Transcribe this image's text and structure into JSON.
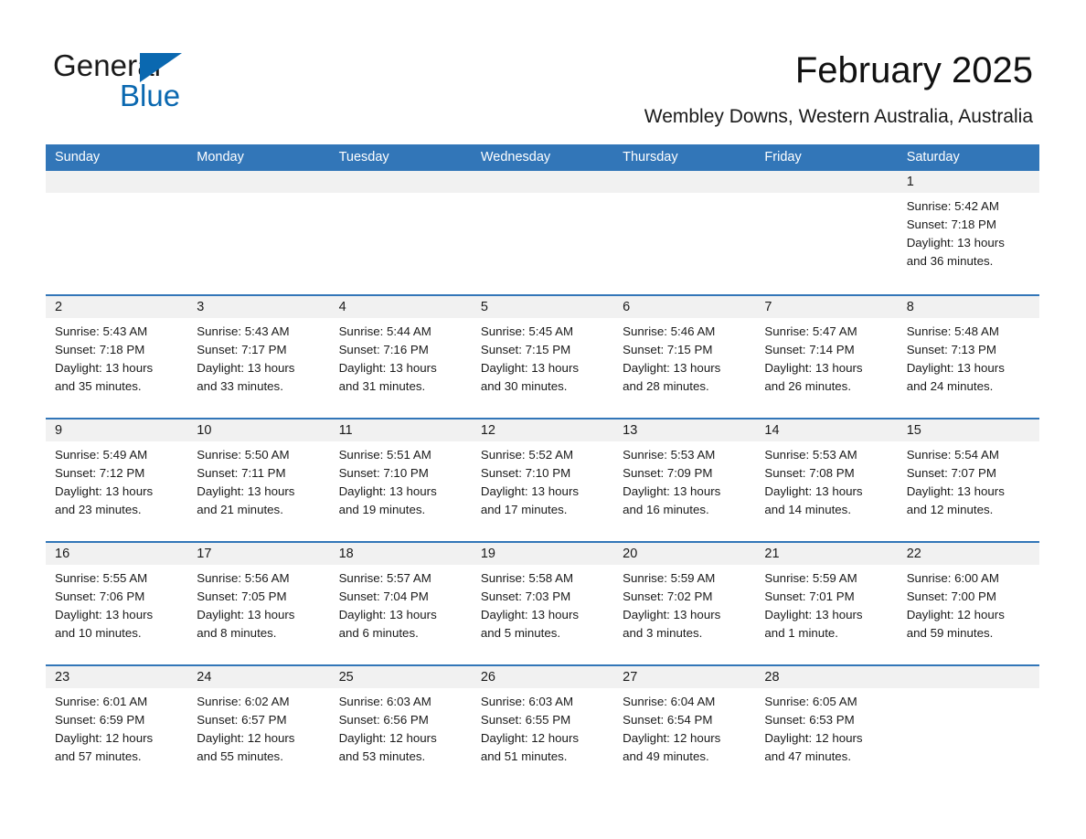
{
  "brand": {
    "name_part1": "General",
    "name_part2": "Blue",
    "accent_color": "#0a68b0"
  },
  "header": {
    "title": "February 2025",
    "subtitle": "Wembley Downs, Western Australia, Australia"
  },
  "calendar": {
    "header_bg": "#3276b8",
    "daynum_bg": "#f1f1f1",
    "day_headers": [
      "Sunday",
      "Monday",
      "Tuesday",
      "Wednesday",
      "Thursday",
      "Friday",
      "Saturday"
    ],
    "labels": {
      "sunrise": "Sunrise:",
      "sunset": "Sunset:",
      "daylight": "Daylight:"
    },
    "weeks": [
      [
        {
          "day": "",
          "empty": true
        },
        {
          "day": "",
          "empty": true
        },
        {
          "day": "",
          "empty": true
        },
        {
          "day": "",
          "empty": true
        },
        {
          "day": "",
          "empty": true
        },
        {
          "day": "",
          "empty": true
        },
        {
          "day": "1",
          "sunrise": "Sunrise: 5:42 AM",
          "sunset": "Sunset: 7:18 PM",
          "daylight_1": "Daylight: 13 hours",
          "daylight_2": "and 36 minutes."
        }
      ],
      [
        {
          "day": "2",
          "sunrise": "Sunrise: 5:43 AM",
          "sunset": "Sunset: 7:18 PM",
          "daylight_1": "Daylight: 13 hours",
          "daylight_2": "and 35 minutes."
        },
        {
          "day": "3",
          "sunrise": "Sunrise: 5:43 AM",
          "sunset": "Sunset: 7:17 PM",
          "daylight_1": "Daylight: 13 hours",
          "daylight_2": "and 33 minutes."
        },
        {
          "day": "4",
          "sunrise": "Sunrise: 5:44 AM",
          "sunset": "Sunset: 7:16 PM",
          "daylight_1": "Daylight: 13 hours",
          "daylight_2": "and 31 minutes."
        },
        {
          "day": "5",
          "sunrise": "Sunrise: 5:45 AM",
          "sunset": "Sunset: 7:15 PM",
          "daylight_1": "Daylight: 13 hours",
          "daylight_2": "and 30 minutes."
        },
        {
          "day": "6",
          "sunrise": "Sunrise: 5:46 AM",
          "sunset": "Sunset: 7:15 PM",
          "daylight_1": "Daylight: 13 hours",
          "daylight_2": "and 28 minutes."
        },
        {
          "day": "7",
          "sunrise": "Sunrise: 5:47 AM",
          "sunset": "Sunset: 7:14 PM",
          "daylight_1": "Daylight: 13 hours",
          "daylight_2": "and 26 minutes."
        },
        {
          "day": "8",
          "sunrise": "Sunrise: 5:48 AM",
          "sunset": "Sunset: 7:13 PM",
          "daylight_1": "Daylight: 13 hours",
          "daylight_2": "and 24 minutes."
        }
      ],
      [
        {
          "day": "9",
          "sunrise": "Sunrise: 5:49 AM",
          "sunset": "Sunset: 7:12 PM",
          "daylight_1": "Daylight: 13 hours",
          "daylight_2": "and 23 minutes."
        },
        {
          "day": "10",
          "sunrise": "Sunrise: 5:50 AM",
          "sunset": "Sunset: 7:11 PM",
          "daylight_1": "Daylight: 13 hours",
          "daylight_2": "and 21 minutes."
        },
        {
          "day": "11",
          "sunrise": "Sunrise: 5:51 AM",
          "sunset": "Sunset: 7:10 PM",
          "daylight_1": "Daylight: 13 hours",
          "daylight_2": "and 19 minutes."
        },
        {
          "day": "12",
          "sunrise": "Sunrise: 5:52 AM",
          "sunset": "Sunset: 7:10 PM",
          "daylight_1": "Daylight: 13 hours",
          "daylight_2": "and 17 minutes."
        },
        {
          "day": "13",
          "sunrise": "Sunrise: 5:53 AM",
          "sunset": "Sunset: 7:09 PM",
          "daylight_1": "Daylight: 13 hours",
          "daylight_2": "and 16 minutes."
        },
        {
          "day": "14",
          "sunrise": "Sunrise: 5:53 AM",
          "sunset": "Sunset: 7:08 PM",
          "daylight_1": "Daylight: 13 hours",
          "daylight_2": "and 14 minutes."
        },
        {
          "day": "15",
          "sunrise": "Sunrise: 5:54 AM",
          "sunset": "Sunset: 7:07 PM",
          "daylight_1": "Daylight: 13 hours",
          "daylight_2": "and 12 minutes."
        }
      ],
      [
        {
          "day": "16",
          "sunrise": "Sunrise: 5:55 AM",
          "sunset": "Sunset: 7:06 PM",
          "daylight_1": "Daylight: 13 hours",
          "daylight_2": "and 10 minutes."
        },
        {
          "day": "17",
          "sunrise": "Sunrise: 5:56 AM",
          "sunset": "Sunset: 7:05 PM",
          "daylight_1": "Daylight: 13 hours",
          "daylight_2": "and 8 minutes."
        },
        {
          "day": "18",
          "sunrise": "Sunrise: 5:57 AM",
          "sunset": "Sunset: 7:04 PM",
          "daylight_1": "Daylight: 13 hours",
          "daylight_2": "and 6 minutes."
        },
        {
          "day": "19",
          "sunrise": "Sunrise: 5:58 AM",
          "sunset": "Sunset: 7:03 PM",
          "daylight_1": "Daylight: 13 hours",
          "daylight_2": "and 5 minutes."
        },
        {
          "day": "20",
          "sunrise": "Sunrise: 5:59 AM",
          "sunset": "Sunset: 7:02 PM",
          "daylight_1": "Daylight: 13 hours",
          "daylight_2": "and 3 minutes."
        },
        {
          "day": "21",
          "sunrise": "Sunrise: 5:59 AM",
          "sunset": "Sunset: 7:01 PM",
          "daylight_1": "Daylight: 13 hours",
          "daylight_2": "and 1 minute."
        },
        {
          "day": "22",
          "sunrise": "Sunrise: 6:00 AM",
          "sunset": "Sunset: 7:00 PM",
          "daylight_1": "Daylight: 12 hours",
          "daylight_2": "and 59 minutes."
        }
      ],
      [
        {
          "day": "23",
          "sunrise": "Sunrise: 6:01 AM",
          "sunset": "Sunset: 6:59 PM",
          "daylight_1": "Daylight: 12 hours",
          "daylight_2": "and 57 minutes."
        },
        {
          "day": "24",
          "sunrise": "Sunrise: 6:02 AM",
          "sunset": "Sunset: 6:57 PM",
          "daylight_1": "Daylight: 12 hours",
          "daylight_2": "and 55 minutes."
        },
        {
          "day": "25",
          "sunrise": "Sunrise: 6:03 AM",
          "sunset": "Sunset: 6:56 PM",
          "daylight_1": "Daylight: 12 hours",
          "daylight_2": "and 53 minutes."
        },
        {
          "day": "26",
          "sunrise": "Sunrise: 6:03 AM",
          "sunset": "Sunset: 6:55 PM",
          "daylight_1": "Daylight: 12 hours",
          "daylight_2": "and 51 minutes."
        },
        {
          "day": "27",
          "sunrise": "Sunrise: 6:04 AM",
          "sunset": "Sunset: 6:54 PM",
          "daylight_1": "Daylight: 12 hours",
          "daylight_2": "and 49 minutes."
        },
        {
          "day": "28",
          "sunrise": "Sunrise: 6:05 AM",
          "sunset": "Sunset: 6:53 PM",
          "daylight_1": "Daylight: 12 hours",
          "daylight_2": "and 47 minutes."
        },
        {
          "day": "",
          "empty": true
        }
      ]
    ]
  }
}
